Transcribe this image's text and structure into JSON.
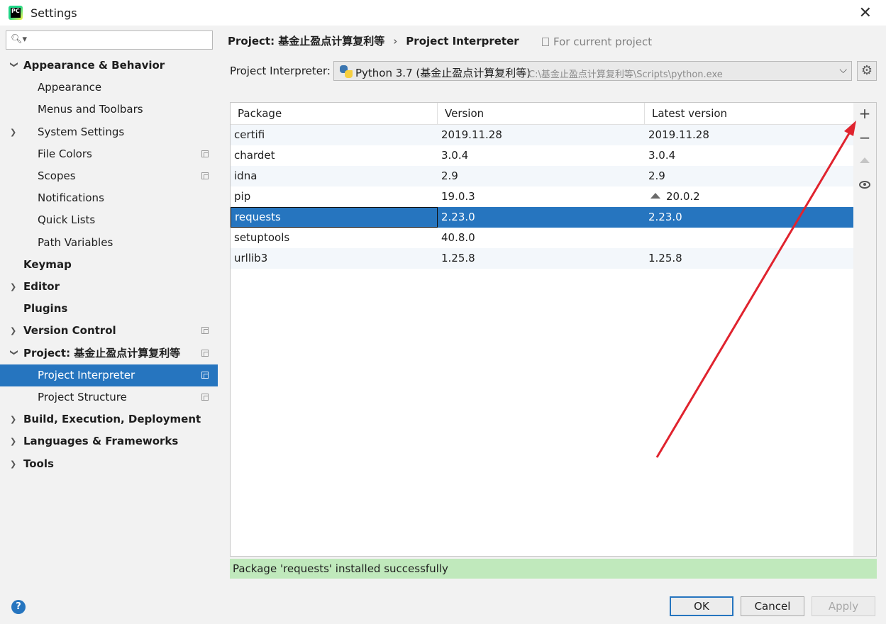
{
  "window": {
    "title": "Settings"
  },
  "search": {
    "placeholder": ""
  },
  "sidebar": {
    "items": [
      {
        "label": "Appearance & Behavior",
        "level": 0,
        "bold": true,
        "arrow": "down",
        "copy": false
      },
      {
        "label": "Appearance",
        "level": 1,
        "bold": false,
        "arrow": "",
        "copy": false
      },
      {
        "label": "Menus and Toolbars",
        "level": 1,
        "bold": false,
        "arrow": "",
        "copy": false
      },
      {
        "label": "System Settings",
        "level": 1,
        "bold": false,
        "arrow": "right",
        "copy": false
      },
      {
        "label": "File Colors",
        "level": 1,
        "bold": false,
        "arrow": "",
        "copy": true
      },
      {
        "label": "Scopes",
        "level": 1,
        "bold": false,
        "arrow": "",
        "copy": true
      },
      {
        "label": "Notifications",
        "level": 1,
        "bold": false,
        "arrow": "",
        "copy": false
      },
      {
        "label": "Quick Lists",
        "level": 1,
        "bold": false,
        "arrow": "",
        "copy": false
      },
      {
        "label": "Path Variables",
        "level": 1,
        "bold": false,
        "arrow": "",
        "copy": false
      },
      {
        "label": "Keymap",
        "level": 0,
        "bold": true,
        "arrow": "",
        "copy": false
      },
      {
        "label": "Editor",
        "level": 0,
        "bold": true,
        "arrow": "right",
        "copy": false
      },
      {
        "label": "Plugins",
        "level": 0,
        "bold": true,
        "arrow": "",
        "copy": false
      },
      {
        "label": "Version Control",
        "level": 0,
        "bold": true,
        "arrow": "right",
        "copy": true
      },
      {
        "label": "Project: 基金止盈点计算复利等",
        "level": 0,
        "bold": true,
        "arrow": "down",
        "copy": true
      },
      {
        "label": "Project Interpreter",
        "level": 1,
        "bold": false,
        "arrow": "",
        "copy": true,
        "selected": true
      },
      {
        "label": "Project Structure",
        "level": 1,
        "bold": false,
        "arrow": "",
        "copy": true
      },
      {
        "label": "Build, Execution, Deployment",
        "level": 0,
        "bold": true,
        "arrow": "right",
        "copy": false
      },
      {
        "label": "Languages & Frameworks",
        "level": 0,
        "bold": true,
        "arrow": "right",
        "copy": false
      },
      {
        "label": "Tools",
        "level": 0,
        "bold": true,
        "arrow": "right",
        "copy": false
      }
    ]
  },
  "breadcrumb": {
    "project": "Project: 基金止盈点计算复利等",
    "separator": "›",
    "page": "Project Interpreter"
  },
  "scope_note": "For current project",
  "interpreter": {
    "label": "Project Interpreter:",
    "name": "Python 3.7 (基金止盈点计算复利等)",
    "path": "C:\\基金止盈点计算复利等\\Scripts\\python.exe"
  },
  "table": {
    "columns": [
      "Package",
      "Version",
      "Latest version"
    ],
    "rows": [
      {
        "package": "certifi",
        "version": "2019.11.28",
        "latest": "2019.11.28",
        "upgrade": false
      },
      {
        "package": "chardet",
        "version": "3.0.4",
        "latest": "3.0.4",
        "upgrade": false
      },
      {
        "package": "idna",
        "version": "2.9",
        "latest": "2.9",
        "upgrade": false
      },
      {
        "package": "pip",
        "version": "19.0.3",
        "latest": "20.0.2",
        "upgrade": true
      },
      {
        "package": "requests",
        "version": "2.23.0",
        "latest": "2.23.0",
        "upgrade": false,
        "selected": true
      },
      {
        "package": "setuptools",
        "version": "40.8.0",
        "latest": "",
        "upgrade": false
      },
      {
        "package": "urllib3",
        "version": "1.25.8",
        "latest": "1.25.8",
        "upgrade": false
      }
    ]
  },
  "tools": {
    "add": "+",
    "remove": "−"
  },
  "status": {
    "message": "Package 'requests' installed successfully"
  },
  "footer": {
    "help": "?",
    "ok": "OK",
    "cancel": "Cancel",
    "apply": "Apply"
  },
  "colors": {
    "accent": "#2675bf",
    "status_bg": "#c0e9bc",
    "arrow": "#e0232e"
  }
}
